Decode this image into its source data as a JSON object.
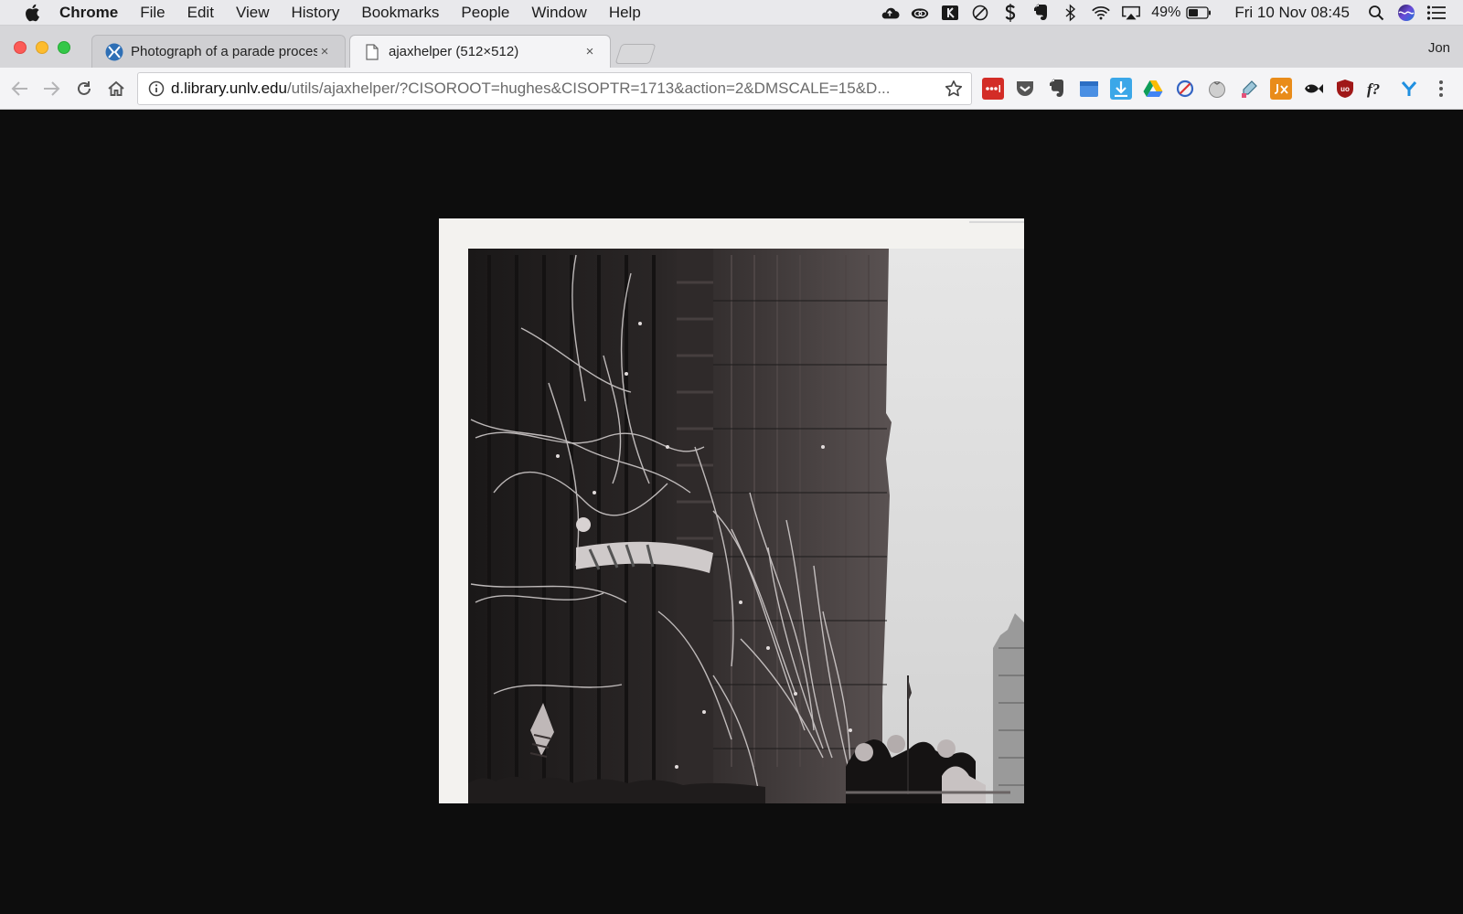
{
  "menubar": {
    "app_name": "Chrome",
    "items": [
      "File",
      "Edit",
      "View",
      "History",
      "Bookmarks",
      "People",
      "Window",
      "Help"
    ],
    "battery_percent": "49%",
    "clock": "Fri 10 Nov  08:45",
    "status_icons": [
      "cloud-upload-icon",
      "creative-cloud-icon",
      "keyboard-viewer-icon",
      "no-entry-icon",
      "s-icon",
      "evernote-icon",
      "bluetooth-icon",
      "wifi-icon",
      "airplay-icon",
      "battery-icon",
      "spotlight-icon",
      "siri-icon",
      "notification-center-icon"
    ]
  },
  "tabs": [
    {
      "title": "Photograph of a parade proces",
      "close": "×",
      "active": false
    },
    {
      "title": "ajaxhelper (512×512)",
      "close": "×",
      "active": true
    }
  ],
  "profile_name": "Jon",
  "omnibox": {
    "host": "d.library.unlv.edu",
    "path": "/utils/ajaxhelper/?CISOROOT=hughes&CISOPTR=1713&action=2&DMSCALE=15&D..."
  },
  "extensions": [
    "lastpass-icon",
    "pocket-icon",
    "evernote-icon",
    "calendar-icon",
    "download-icon",
    "google-drive-icon",
    "block-icon",
    "tomato-icon",
    "eyedropper-icon",
    "jx-icon",
    "fish-icon",
    "ublock-icon",
    "font-finder-icon",
    "y-icon"
  ],
  "image": {
    "description_name": "parade-photograph"
  },
  "colors": {
    "background": "#0d0d0d",
    "close": "#fc5b57",
    "minimize": "#fdbc2e",
    "maximize": "#33c748"
  }
}
